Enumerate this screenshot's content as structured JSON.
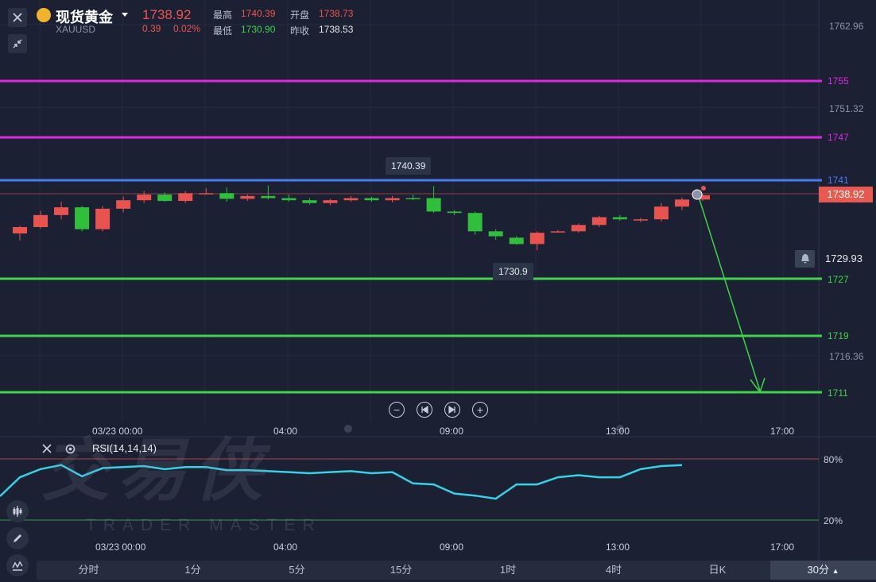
{
  "header": {
    "name": "现货黄金",
    "symbol": "XAUUSD",
    "price": "1738.92",
    "change": "0.39",
    "change_pct": "0.02%",
    "quotes": [
      {
        "label": "最高",
        "value": "1740.39",
        "color": "#f0524f"
      },
      {
        "label": "开盘",
        "value": "1738.73",
        "color": "#f0524f"
      },
      {
        "label": "最低",
        "value": "1730.90",
        "color": "#3fd24a"
      },
      {
        "label": "昨收",
        "value": "1738.53",
        "color": "#e6e9f0"
      }
    ]
  },
  "levels": [
    {
      "label": "1755",
      "color": "#e026e0"
    },
    {
      "label": "1747",
      "color": "#e026e0"
    },
    {
      "label": "1741",
      "color": "#4a7af0"
    },
    {
      "label": "1727",
      "color": "#3fd24a"
    },
    {
      "label": "1719",
      "color": "#3fd24a"
    },
    {
      "label": "1711",
      "color": "#3fd24a"
    }
  ],
  "price_axis": [
    "1762.96",
    "1751.32",
    "1716.36"
  ],
  "current_price_tag": "1738.92",
  "alert_price": "1729.93",
  "high_marker": "1740.39",
  "low_marker": "1730.9",
  "time_axis": [
    "03/23 00:00",
    "04:00",
    "09:00",
    "13:00",
    "17:00"
  ],
  "rsi": {
    "label": "RSI(14,14,14)",
    "upper": "80%",
    "lower": "20%"
  },
  "watermark": {
    "cn": "交易侠",
    "en": "TRADER MASTER"
  },
  "periods": [
    "分时",
    "1分",
    "5分",
    "15分",
    "1时",
    "4时",
    "日K",
    "30分"
  ],
  "chart_data": [
    {
      "type": "candlestick",
      "title": "现货黄金 XAUUSD 30分",
      "x": [
        "03/23 00:00",
        "00:30",
        "01:00",
        "01:30",
        "02:00",
        "02:30",
        "03:00",
        "03:30",
        "04:00",
        "04:30",
        "05:00",
        "05:30",
        "06:00",
        "06:30",
        "07:00",
        "07:30",
        "08:00",
        "08:30",
        "09:00",
        "09:30",
        "10:00",
        "10:30",
        "11:00",
        "11:30",
        "12:00",
        "12:30",
        "13:00",
        "13:30",
        "14:00",
        "14:30",
        "15:00",
        "15:30",
        "16:00",
        "16:30",
        "17:00"
      ],
      "ohlc": [
        [
          1733.3,
          1734.4,
          1732.3,
          1734.2
        ],
        [
          1734.2,
          1736.5,
          1734.0,
          1735.9
        ],
        [
          1735.9,
          1737.8,
          1735.3,
          1737.0
        ],
        [
          1737.0,
          1737.2,
          1733.6,
          1733.9
        ],
        [
          1733.9,
          1737.2,
          1733.6,
          1736.8
        ],
        [
          1736.8,
          1738.5,
          1736.3,
          1738.0
        ],
        [
          1738.0,
          1739.3,
          1737.6,
          1738.8
        ],
        [
          1738.8,
          1739.1,
          1737.8,
          1737.9
        ],
        [
          1737.9,
          1739.3,
          1737.6,
          1739.0
        ],
        [
          1739.0,
          1739.7,
          1738.8,
          1739.0
        ],
        [
          1739.0,
          1739.8,
          1737.8,
          1738.2
        ],
        [
          1738.2,
          1738.8,
          1737.9,
          1738.6
        ],
        [
          1738.6,
          1740.1,
          1738.1,
          1738.3
        ],
        [
          1738.3,
          1738.8,
          1737.8,
          1738.0
        ],
        [
          1738.0,
          1738.3,
          1737.4,
          1737.6
        ],
        [
          1737.6,
          1738.2,
          1737.3,
          1738.0
        ],
        [
          1738.0,
          1738.6,
          1737.8,
          1738.3
        ],
        [
          1738.3,
          1738.5,
          1737.8,
          1738.0
        ],
        [
          1738.0,
          1738.6,
          1737.7,
          1738.3
        ],
        [
          1738.3,
          1738.8,
          1738.0,
          1738.2
        ],
        [
          1738.3,
          1740.0,
          1736.2,
          1736.4
        ],
        [
          1736.4,
          1736.6,
          1735.9,
          1736.2
        ],
        [
          1736.2,
          1736.4,
          1733.1,
          1733.6
        ],
        [
          1733.6,
          1733.9,
          1732.4,
          1732.9
        ],
        [
          1732.7,
          1732.9,
          1731.7,
          1731.8
        ],
        [
          1731.8,
          1733.6,
          1730.9,
          1733.4
        ],
        [
          1733.6,
          1733.8,
          1733.4,
          1733.6
        ],
        [
          1733.6,
          1734.7,
          1733.4,
          1734.5
        ],
        [
          1734.5,
          1735.8,
          1734.2,
          1735.6
        ],
        [
          1735.6,
          1735.9,
          1735.1,
          1735.3
        ],
        [
          1735.3,
          1735.5,
          1734.9,
          1735.3
        ],
        [
          1735.3,
          1737.6,
          1735.0,
          1737.1
        ],
        [
          1737.1,
          1738.4,
          1736.6,
          1738.1
        ],
        [
          1738.1,
          1738.9,
          1737.9,
          1738.7
        ]
      ],
      "ylim": [
        1710,
        1763
      ],
      "grid": true
    },
    {
      "type": "line",
      "title": "RSI(14,14,14)",
      "series": [
        {
          "name": "RSI(14,14,14)",
          "values": [
            62,
            70,
            74,
            63,
            71,
            72,
            73,
            70,
            72,
            72,
            69,
            69,
            68,
            67,
            66,
            67,
            68,
            66,
            67,
            56,
            55,
            46,
            44,
            41,
            55,
            55,
            62,
            64,
            62,
            62,
            70,
            73,
            74
          ]
        }
      ],
      "ylim": [
        0,
        100
      ]
    }
  ]
}
